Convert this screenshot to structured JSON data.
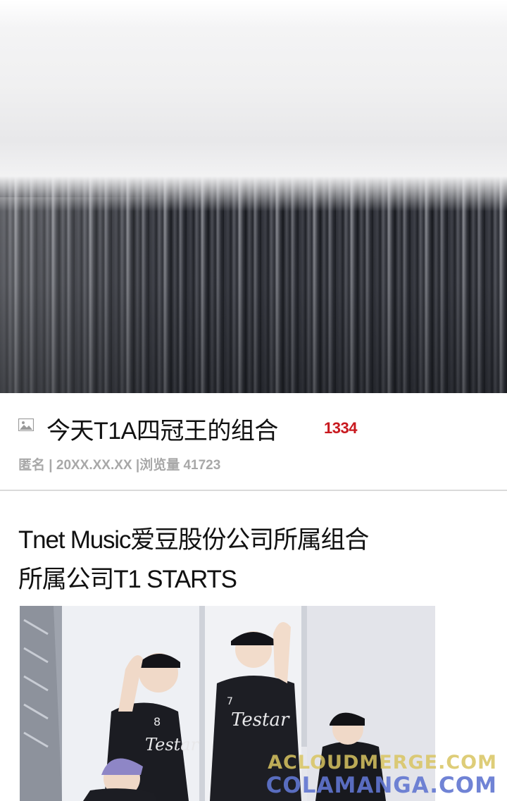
{
  "post": {
    "title": "今天T1A四冠王的组合",
    "count": "1334",
    "meta": "匿名 | 20XX.XX.XX |浏览量 41723"
  },
  "body": {
    "lines": [
      "Tnet Music爱豆股份公司所属组合",
      "所属公司T1 STARTS"
    ]
  },
  "photo": {
    "jersey_text": "Testar",
    "numbers": [
      "8",
      "7"
    ]
  },
  "watermark": {
    "line1": "ACLOUDMERGE.COM",
    "line2": "COLAMANGA.COM"
  },
  "colors": {
    "count": "#c8181e",
    "meta": "#a8a8a8",
    "divider": "#dadada"
  },
  "icons": [
    "image-icon"
  ]
}
